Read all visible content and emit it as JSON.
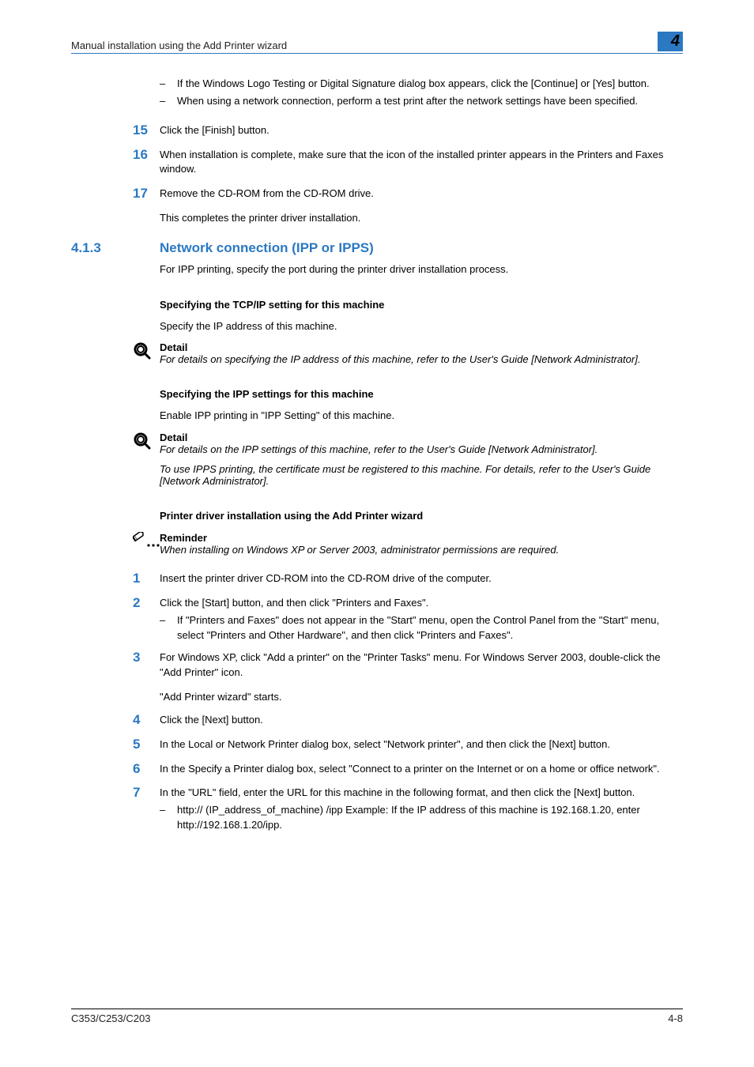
{
  "header": {
    "left": "Manual installation using the Add Printer wizard",
    "chapter": "4"
  },
  "top_subs": [
    "If the Windows Logo Testing or Digital Signature dialog box appears, click the [Continue] or [Yes] button.",
    "When using a network connection, perform a test print after the network settings have been specified."
  ],
  "steps_top": [
    {
      "n": "15",
      "t": "Click the [Finish] button."
    },
    {
      "n": "16",
      "t": "When installation is complete, make sure that the icon of the installed printer appears in the Printers and Faxes window."
    },
    {
      "n": "17",
      "t": "Remove the CD-ROM from the CD-ROM drive."
    }
  ],
  "step17_after": "This completes the printer driver installation.",
  "section": {
    "num": "4.1.3",
    "title": "Network connection (IPP or IPPS)",
    "intro": "For IPP printing, specify the port during the printer driver installation process."
  },
  "tcpip": {
    "heading": "Specifying the TCP/IP setting for this machine",
    "intro": "Specify the IP address of this machine.",
    "detail_label": "Detail",
    "detail_text": "For details on specifying the IP address of this machine, refer to the User's Guide [Network Administrator]."
  },
  "ipp": {
    "heading": "Specifying the IPP settings for this machine",
    "intro": "Enable IPP printing in \"IPP Setting\" of this machine.",
    "detail_label": "Detail",
    "detail_text1": "For details on the IPP settings of this machine, refer to the User's Guide [Network Administrator].",
    "detail_text2": "To use IPPS printing, the certificate must be registered to this machine. For details, refer to the User's Guide [Network Administrator]."
  },
  "wizard": {
    "heading": "Printer driver installation using the Add Printer wizard",
    "reminder_label": "Reminder",
    "reminder_text": "When installing on Windows XP or Server 2003, administrator permissions are required."
  },
  "steps_bottom": [
    {
      "n": "1",
      "t": "Insert the printer driver CD-ROM into the CD-ROM drive of the computer."
    },
    {
      "n": "2",
      "t": "Click the [Start] button, and then click \"Printers and Faxes\".",
      "subs": [
        "If \"Printers and Faxes\" does not appear in the \"Start\" menu, open the Control Panel from the \"Start\" menu, select \"Printers and Other Hardware\", and then click \"Printers and Faxes\"."
      ]
    },
    {
      "n": "3",
      "t": "For Windows XP, click \"Add a printer\" on the \"Printer Tasks\" menu. For Windows Server 2003, double-click the \"Add Printer\" icon.",
      "after": "\"Add Printer wizard\" starts."
    },
    {
      "n": "4",
      "t": "Click the [Next] button."
    },
    {
      "n": "5",
      "t": "In the Local or Network Printer dialog box, select \"Network printer\", and then click the [Next] button."
    },
    {
      "n": "6",
      "t": "In the Specify a Printer dialog box, select \"Connect to a printer on the Internet or on a home or office network\"."
    },
    {
      "n": "7",
      "t": "In the \"URL\" field, enter the URL for this machine in the following format, and then click the [Next] button.",
      "subs": [
        "http:// (IP_address_of_machine) /ipp Example: If the IP address of this machine is 192.168.1.20, enter http://192.168.1.20/ipp."
      ]
    }
  ],
  "footer": {
    "left": "C353/C253/C203",
    "right": "4-8"
  }
}
